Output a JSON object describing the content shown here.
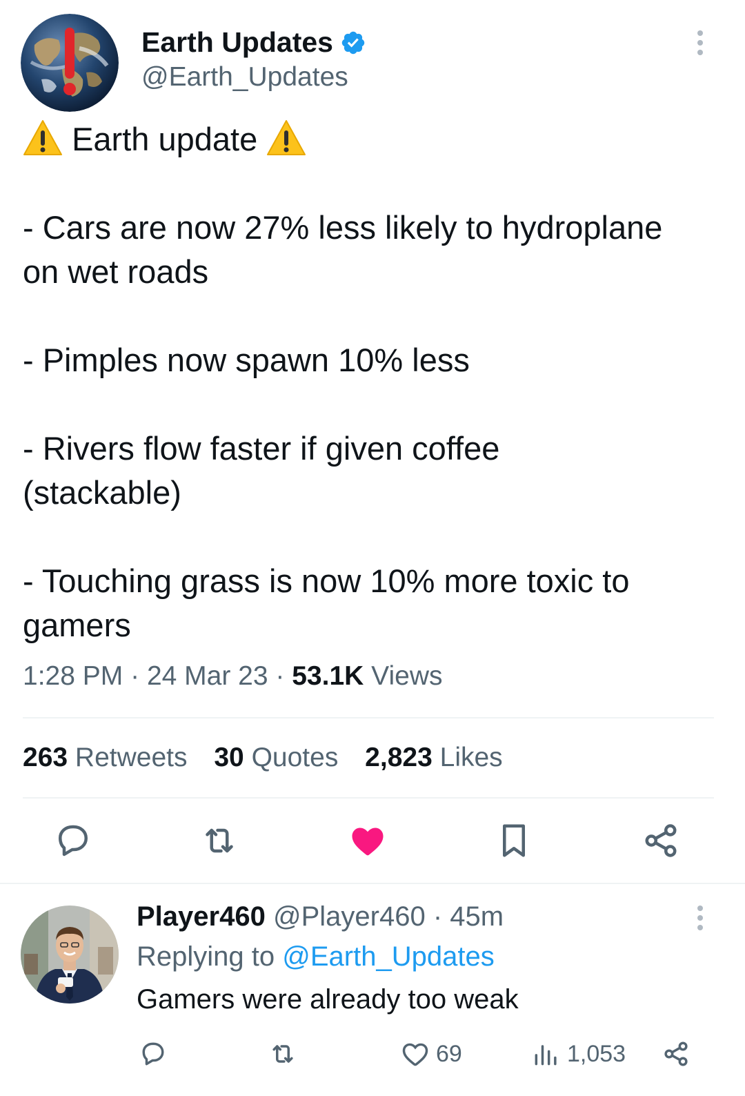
{
  "tweet": {
    "display_name": "Earth Updates",
    "verified": true,
    "handle": "@Earth_Updates",
    "lines": [
      "Earth update",
      "- Cars are now 27% less likely to hydroplane",
      "on wet roads",
      "- Pimples now spawn 10% less",
      "- Rivers flow faster if given coffee",
      "(stackable)",
      "- Touching grass is now 10% more toxic to",
      "gamers"
    ],
    "time": "1:28 PM",
    "date": "24 Mar 23",
    "views_count": "53.1K",
    "views_label": "Views",
    "separator": "·",
    "retweets_count": "263",
    "retweets_label": "Retweets",
    "quotes_count": "30",
    "quotes_label": "Quotes",
    "likes_count": "2,823",
    "likes_label": "Likes",
    "liked": true
  },
  "reply": {
    "display_name": "Player460",
    "handle": "@Player460",
    "separator": "·",
    "age": "45m",
    "replying_prefix": "Replying to",
    "replying_mention": "@Earth_Updates",
    "text": "Gamers were already too weak",
    "likes": "69",
    "views": "1,053"
  },
  "colors": {
    "text": "#0f1419",
    "secondary": "#536471",
    "verified": "#1d9bf0",
    "like_active": "#f91880",
    "divider": "#eff3f4",
    "mention": "#1d9bf0"
  },
  "icons": {
    "verified": "verified-badge-icon",
    "more": "more-dots-icon",
    "warning": "warning-emoji-icon",
    "reply": "reply-icon",
    "retweet": "retweet-icon",
    "like": "heart-icon",
    "bookmark": "bookmark-icon",
    "share": "share-icon",
    "views": "views-chart-icon"
  }
}
